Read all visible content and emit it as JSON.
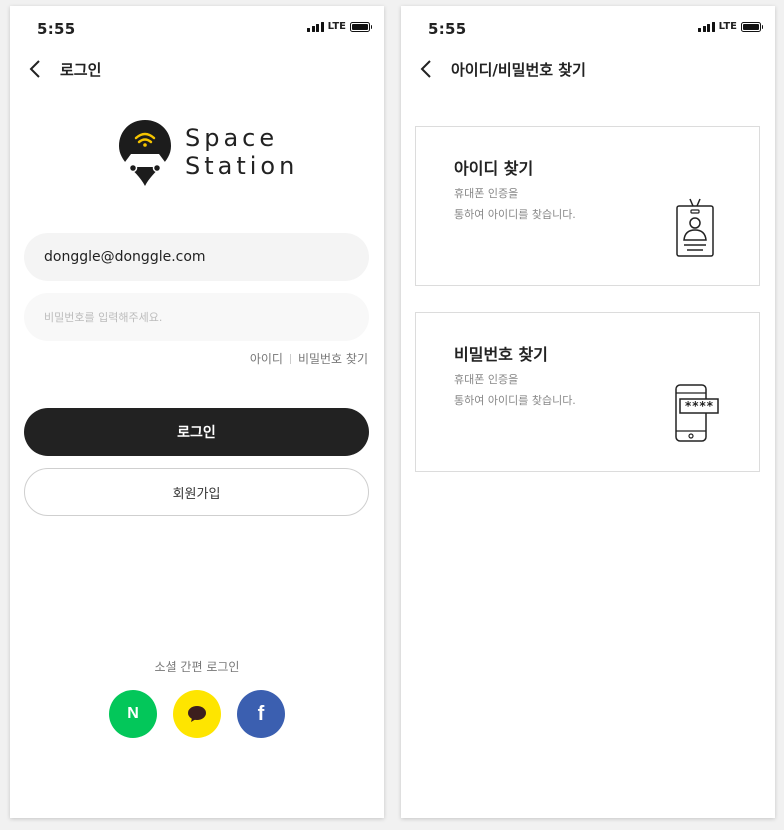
{
  "status_bar": {
    "time": "5:55",
    "network": "LTE"
  },
  "login": {
    "header_title": "로그인",
    "logo_line1": "Space",
    "logo_line2": "Station",
    "id_value": "donggle@donggle.com",
    "password_placeholder": "비밀번호를 입력해주세요.",
    "find_id_link": "아이디",
    "find_password_link": "비밀번호 찾기",
    "login_button": "로그인",
    "signup_button": "회원가입",
    "social_label": "소셜 간편 로그인",
    "social": {
      "naver_letter": "N",
      "facebook_letter": "f"
    }
  },
  "find": {
    "header_title": "아이디/비밀번호 찾기",
    "cards": [
      {
        "title": "아이디 찾기",
        "desc_line1": "휴대폰 인증을",
        "desc_line2": "통하여 아이디를 찾습니다.",
        "icon": "id-badge-icon"
      },
      {
        "title": "비밀번호 찾기",
        "desc_line1": "휴대폰 인증을",
        "desc_line2": "통하여 아이디를 찾습니다.",
        "icon": "phone-password-icon",
        "icon_text": "****"
      }
    ]
  },
  "colors": {
    "naver": "#03c75a",
    "kakao": "#fee500",
    "facebook": "#3b5fb0",
    "primary_button": "#222222",
    "logo_accent": "#f5c400"
  }
}
